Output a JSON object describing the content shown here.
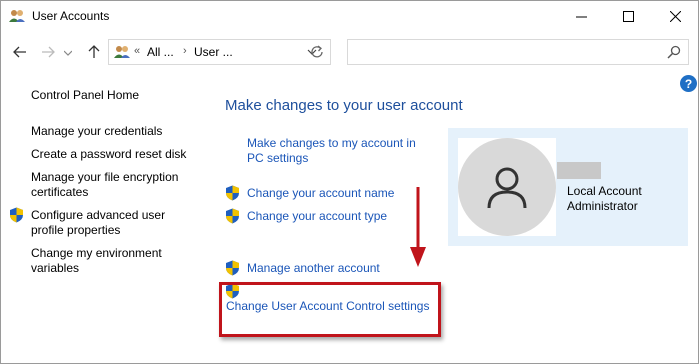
{
  "window": {
    "title": "User Accounts",
    "icon": "user-accounts-icon"
  },
  "window_controls": {
    "minimize_icon": "minimize-icon",
    "maximize_icon": "maximize-icon",
    "close_icon": "close-icon"
  },
  "address_bar": {
    "prefix": "«",
    "crumbs": [
      "All ...",
      "User ..."
    ],
    "separator": "›"
  },
  "search": {
    "placeholder": ""
  },
  "left_pane": {
    "home": "Control Panel Home",
    "links": [
      "Manage your credentials",
      "Create a password reset disk",
      "Manage your file encryption certificates",
      "Configure advanced user profile properties",
      "Change my environment variables"
    ]
  },
  "main": {
    "heading": "Make changes to your user account",
    "pc_settings_link": "Make changes to my account in PC settings",
    "actions": [
      "Change your account name",
      "Change your account type",
      "Manage another account",
      "Change User Account Control settings"
    ]
  },
  "account": {
    "name": "Local Account",
    "role": "Administrator"
  },
  "colors": {
    "link": "#1b56b8",
    "heading": "#1e4f9c",
    "panel": "#e5f1fb",
    "annotation": "#c0141b"
  }
}
